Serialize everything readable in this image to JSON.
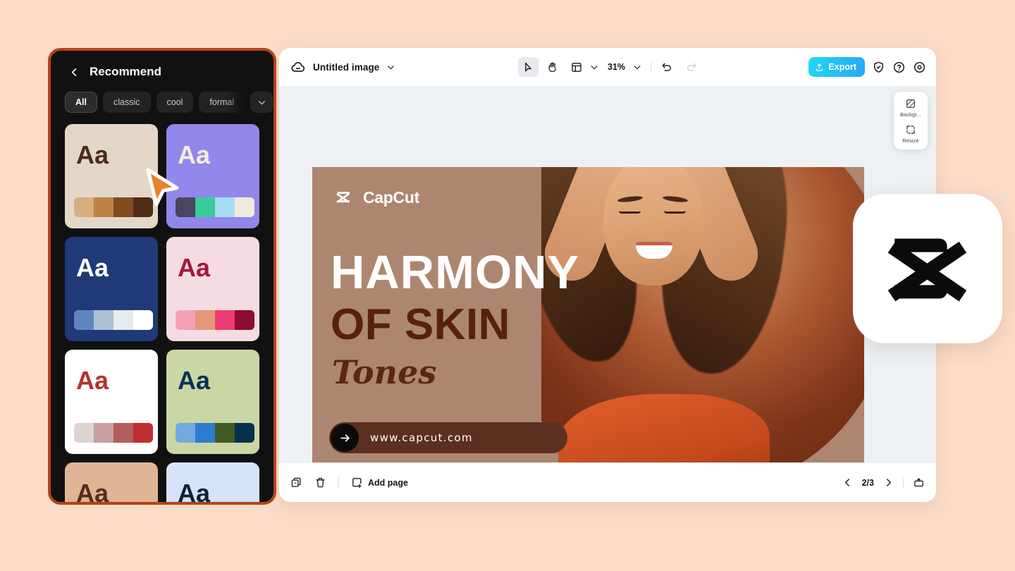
{
  "theme": {
    "page_bg": "#FBDCC8",
    "panel_border": "#B44418",
    "panel_bg": "#111111",
    "canvas_bg": "#EDF1F4",
    "accent_cyan": "#20D8F0",
    "accent_blue": "#29A8F5",
    "cursor_orange": "#E8812A"
  },
  "style_panel": {
    "back_icon": "chevron-left-icon",
    "title": "Recommend",
    "filters": [
      {
        "label": "All",
        "selected": true
      },
      {
        "label": "classic",
        "selected": false
      },
      {
        "label": "cool",
        "selected": false
      },
      {
        "label": "formal",
        "selected": false
      }
    ],
    "more_filters_icon": "chevron-down-icon",
    "cards": [
      {
        "sample_text": "Aa",
        "bg": "#E3D7C9",
        "text_color": "#4A2B1B",
        "swatch": [
          "#D7AE80",
          "#BE8344",
          "#7E4C20",
          "#4E2C16"
        ]
      },
      {
        "sample_text": "Aa",
        "bg": "#9287EA",
        "text_color": "#F2EDDC",
        "swatch": [
          "#4A4560",
          "#3ACC98",
          "#A6DDF5",
          "#F0EBDC"
        ]
      },
      {
        "sample_text": "Aa",
        "bg": "#203A77",
        "text_color": "#FFFFFF",
        "swatch": [
          "#5E85BE",
          "#AEC0D4",
          "#E7EAEF",
          "#FFFFFF"
        ]
      },
      {
        "sample_text": "Aa",
        "bg": "#F5DCE2",
        "text_color": "#A8143E",
        "swatch": [
          "#F3A2B6",
          "#E0997A",
          "#EE3C72",
          "#8C0A33"
        ]
      },
      {
        "sample_text": "Aa",
        "bg": "#FFFFFF",
        "text_color": "#B6302F",
        "swatch": [
          "#DFD3D2",
          "#C79F9F",
          "#B35E5C",
          "#BE2E2E"
        ]
      },
      {
        "sample_text": "Aa",
        "bg": "#CBD6A5",
        "text_color": "#0D3150",
        "swatch": [
          "#77A7DF",
          "#2E7CD0",
          "#3F5A24",
          "#05314E"
        ]
      },
      {
        "sample_text": "Aa",
        "bg": "#DFB595",
        "text_color": "#5B2A1C",
        "swatch": []
      },
      {
        "sample_text": "Aa",
        "bg": "#D7E3FA",
        "text_color": "#0E2237",
        "swatch": []
      }
    ]
  },
  "editor": {
    "toolbar": {
      "cloud_icon": "cloud-icon",
      "doc_title": "Untitled image",
      "title_dropdown_icon": "chevron-down-icon",
      "select_tool_icon": "cursor-arrow-icon",
      "hand_tool_icon": "hand-icon",
      "layout_tool_icon": "layout-icon",
      "layout_dropdown_icon": "chevron-down-icon",
      "zoom_level": "31%",
      "zoom_dropdown_icon": "chevron-down-icon",
      "undo_icon": "undo-icon",
      "redo_icon": "redo-icon",
      "export_label": "Export",
      "export_icon": "upload-icon",
      "shield_icon": "shield-check-icon",
      "help_icon": "question-circle-icon",
      "settings_icon": "gear-icon"
    },
    "float_tools": [
      {
        "label": "Backgr...",
        "icon": "background-icon"
      },
      {
        "label": "Resize",
        "icon": "resize-icon"
      }
    ],
    "bottom_bar": {
      "duplicate_icon": "duplicate-icon",
      "delete_icon": "trash-icon",
      "add_page_icon": "add-page-icon",
      "add_page_label": "Add page",
      "prev_icon": "chevron-left-icon",
      "page_indicator": "2/3",
      "next_icon": "chevron-right-icon",
      "present_icon": "present-icon"
    }
  },
  "design": {
    "brand_name": "CapCut",
    "brand_logo_icon": "capcut-logo-icon",
    "headline_1": "HARMONY",
    "headline_2": "OF SKIN",
    "headline_3": "Tones",
    "url_text": "www.capcut.com",
    "url_arrow_icon": "arrow-right-icon",
    "bg_color": "#AD8671",
    "headline_1_color": "#FFFFFF",
    "headline_2_color": "#57200F",
    "pill_color": "#5C3020"
  },
  "logo_badge": {
    "icon": "capcut-logo-icon"
  },
  "cursor": {
    "icon": "cursor-arrow-icon"
  }
}
